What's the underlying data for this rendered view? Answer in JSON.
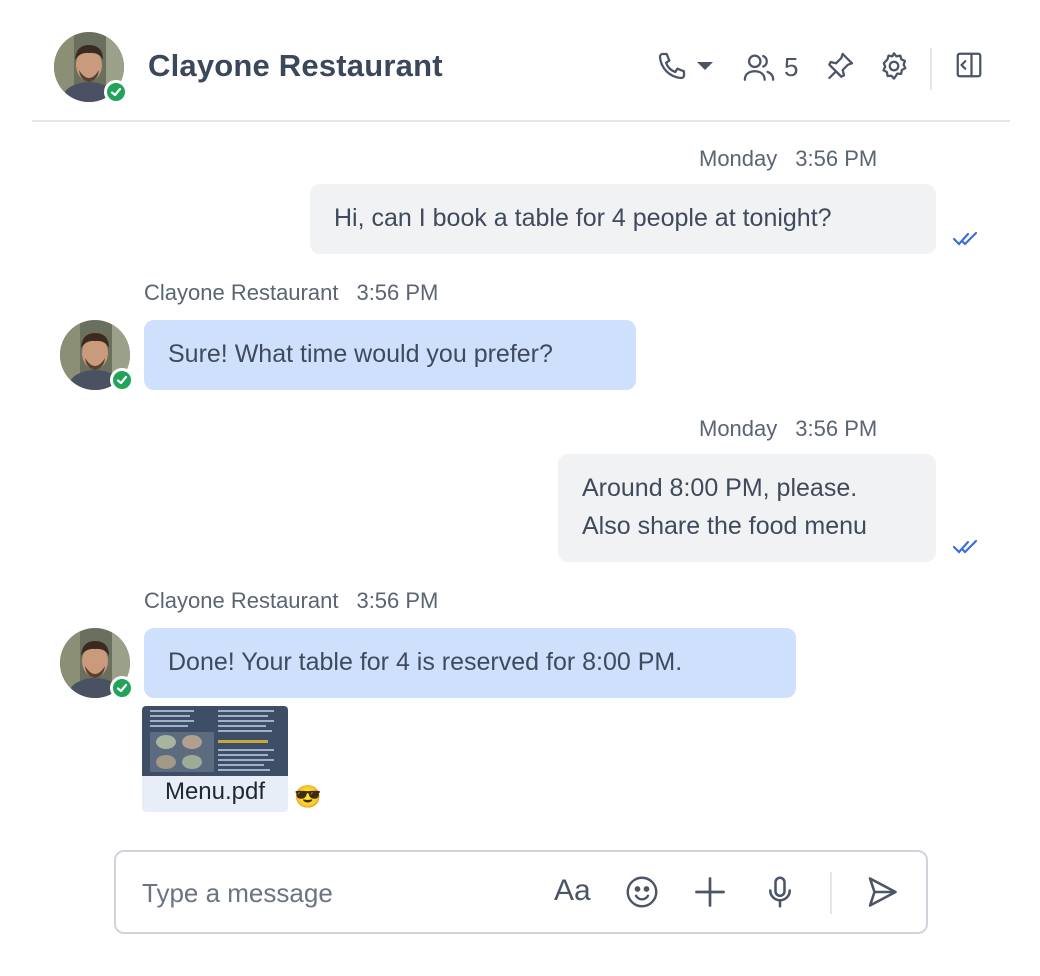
{
  "header": {
    "title": "Clayone Restaurant",
    "participants_count": "5"
  },
  "messages": [
    {
      "day": "Monday",
      "time": "3:56 PM",
      "text": "Hi, can I book a table for 4 people at tonight?"
    },
    {
      "sender": "Clayone Restaurant",
      "time": "3:56 PM",
      "text": "Sure! What time would you prefer?"
    },
    {
      "day": "Monday",
      "time": "3:56 PM",
      "line1": "Around 8:00 PM, please.",
      "line2": "Also share the food menu"
    },
    {
      "sender": "Clayone Restaurant",
      "time": "3:56 PM",
      "text": "Done! Your table for 4 is reserved for 8:00 PM."
    }
  ],
  "attachment": {
    "filename": "Menu.pdf",
    "reaction": "😎"
  },
  "composer": {
    "placeholder": "Type a message",
    "format_label": "Aa"
  },
  "colors": {
    "incoming_bubble": "#cfe0fd",
    "outgoing_bubble": "#f1f2f4",
    "online": "#22a35a",
    "read_ticks": "#3b6fd8"
  },
  "icons": [
    "phone-icon",
    "chevron-down-icon",
    "users-icon",
    "pin-icon",
    "gear-icon",
    "sidebar-toggle-icon",
    "double-check-icon",
    "text-format-icon",
    "smiley-icon",
    "plus-icon",
    "microphone-icon",
    "send-icon"
  ]
}
